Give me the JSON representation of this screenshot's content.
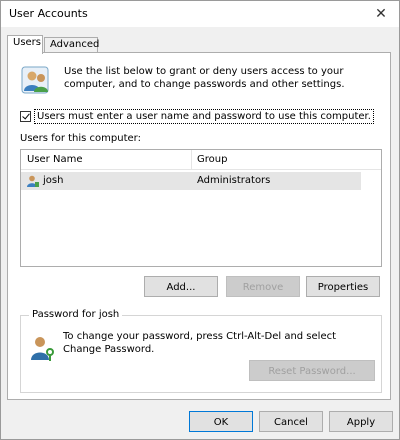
{
  "window": {
    "title": "User Accounts",
    "close_glyph": "✕"
  },
  "tabs": [
    {
      "label": "Users",
      "active": true
    },
    {
      "label": "Advanced",
      "active": false
    }
  ],
  "intro": "Use the list below to grant or deny users access to your computer, and to change passwords and other settings.",
  "must_login": {
    "label": "Users must enter a user name and password to use this computer.",
    "checked": true
  },
  "users_label": "Users for this computer:",
  "list": {
    "columns": [
      "User Name",
      "Group"
    ],
    "rows": [
      {
        "name": "josh",
        "group": "Administrators"
      }
    ]
  },
  "buttons": {
    "add": "Add...",
    "remove": "Remove",
    "properties": "Properties",
    "reset_password": "Reset Password...",
    "ok": "OK",
    "cancel": "Cancel",
    "apply": "Apply"
  },
  "password_group": {
    "title": "Password for josh",
    "text": "To change your password, press Ctrl-Alt-Del and select Change Password."
  },
  "icons": {
    "user_accounts": "users-icon",
    "user_row": "user-icon",
    "password": "user-key-icon"
  },
  "colors": {
    "accent": "#0078d7",
    "disabled_text": "#a0a0a0"
  }
}
